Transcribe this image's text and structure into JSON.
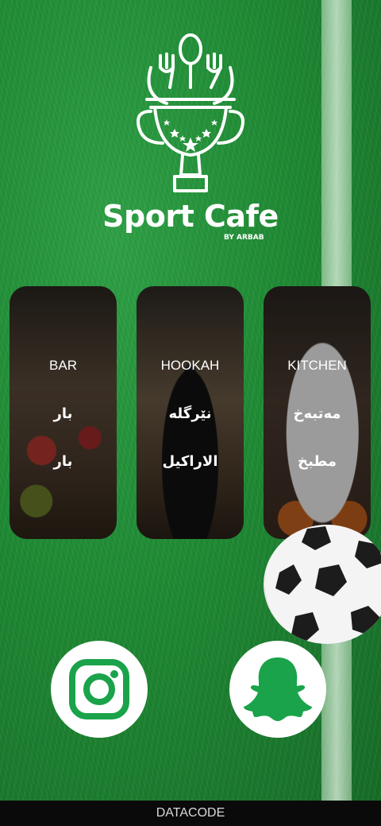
{
  "brand": {
    "name": "Sport Cafe",
    "subtitle": "BY ARBAB"
  },
  "cards": [
    {
      "en": "BAR",
      "ku": "بار",
      "ar": "بار"
    },
    {
      "en": "HOOKAH",
      "ku": "نێرگله",
      "ar": "الاراكيل"
    },
    {
      "en": "KITCHEN",
      "ku": "مەتبەخ",
      "ar": "مطبخ"
    }
  ],
  "social": {
    "instagram": "instagram-icon",
    "snapchat": "snapchat-icon"
  },
  "footer": {
    "text": "DATACODE"
  },
  "colors": {
    "grass": "#1f8a34",
    "accent": "#1aa34a",
    "footer_bg": "#0a0a0a"
  }
}
